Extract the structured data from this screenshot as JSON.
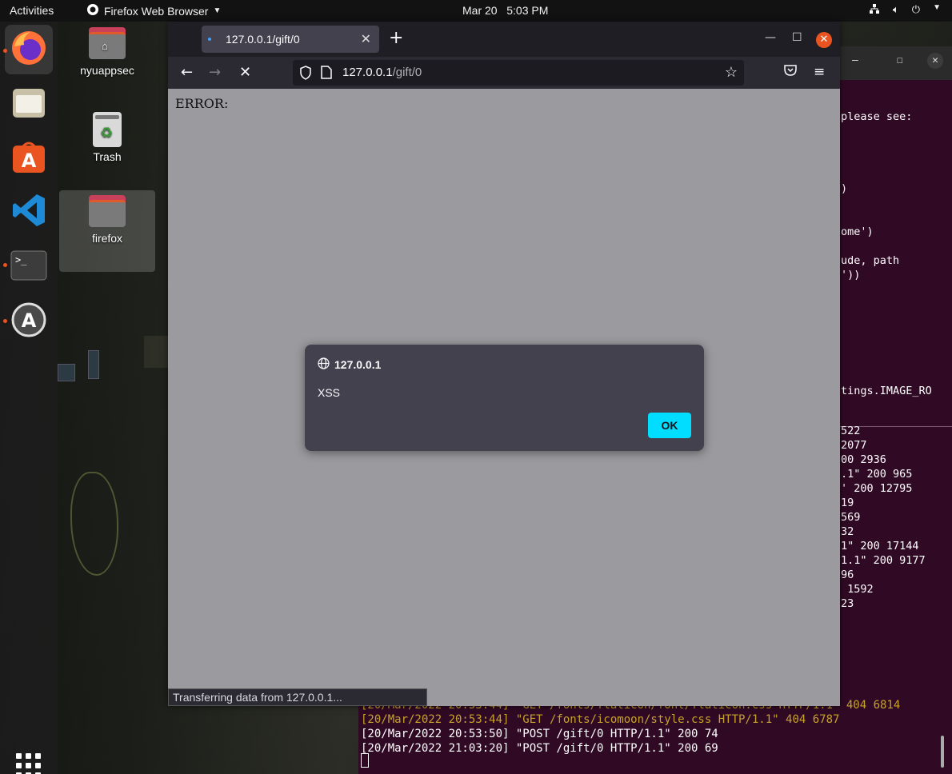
{
  "topbar": {
    "activities": "Activities",
    "app_name": "Firefox Web Browser",
    "date": "Mar 20",
    "time": "5:03 PM"
  },
  "dock": {
    "items": [
      "firefox-icon",
      "files-icon",
      "software-store-icon",
      "vscode-icon",
      "terminal-icon",
      "update-icon"
    ],
    "show_apps": "apps-grid-icon"
  },
  "desktop": {
    "icons": [
      {
        "label": "nyuappsec"
      },
      {
        "label": "Trash"
      },
      {
        "label": "firefox"
      }
    ]
  },
  "browser": {
    "tab_title": "127.0.0.1/gift/0",
    "url_host": "127.0.0.1",
    "url_path": "/gift/0",
    "page_text": "ERROR:",
    "status": "Transferring data from 127.0.0.1..."
  },
  "dialog": {
    "origin": "127.0.0.1",
    "message": "XSS",
    "ok_label": "OK"
  },
  "terminal": {
    "side_lines": [
      "please see:",
      ")",
      "ome')",
      "ude, path",
      "'))",
      "tings.IMAGE_RO",
      "522",
      "2077",
      "00 2936",
      ".1\" 200 965",
      "' 200 12795",
      "19",
      "569",
      "32",
      "1\" 200 17144",
      "1.1\" 200 9177",
      "96",
      " 1592",
      "23"
    ],
    "bottom_lines": [
      "[20/Mar/2022 20:53:44] \"GET /fonts/flaticon/font/flaticon.css HTTP/1.1\" 404 6814",
      "[20/Mar/2022 20:53:44] \"GET /fonts/icomoon/style.css HTTP/1.1\" 404 6787",
      "[20/Mar/2022 20:53:50] \"POST /gift/0 HTTP/1.1\" 200 74",
      "[20/Mar/2022 21:03:20] \"POST /gift/0 HTTP/1.1\" 200 69"
    ]
  },
  "colors": {
    "accent": "#e95420",
    "ok_button": "#00ddff",
    "terminal_bg": "#300a24"
  }
}
